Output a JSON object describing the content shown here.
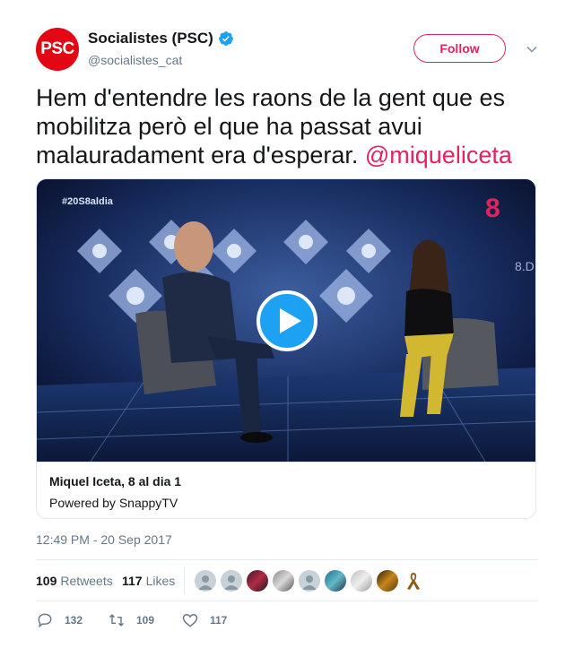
{
  "tweet": {
    "author": {
      "display_name": "Socialistes (PSC)",
      "handle": "@socialistes_cat",
      "avatar_text": "PSC",
      "avatar_color": "#e30613",
      "verified": true
    },
    "follow_label": "Follow",
    "text": "Hem d'entendre les raons de la gent que es mobilitza però el que ha passat avui malauradament era d'esperar.",
    "mention": "@miqueliceta",
    "accent_color": "#e0245e",
    "card": {
      "title": "Miquel Iceta, 8 al dia 1",
      "source": "Powered by SnappyTV",
      "video_overlay_hashtag": "#20S8aldia",
      "video_overlay_channel": "8",
      "video_overlay_number": "8.D",
      "play_icon": "play-icon"
    },
    "timestamp": "12:49 PM - 20 Sep 2017",
    "stats": {
      "retweets_count": "109",
      "retweets_label": "Retweets",
      "likes_count": "117",
      "likes_label": "Likes"
    },
    "actions": {
      "reply_count": "132",
      "retweet_count": "109",
      "like_count": "117"
    }
  }
}
